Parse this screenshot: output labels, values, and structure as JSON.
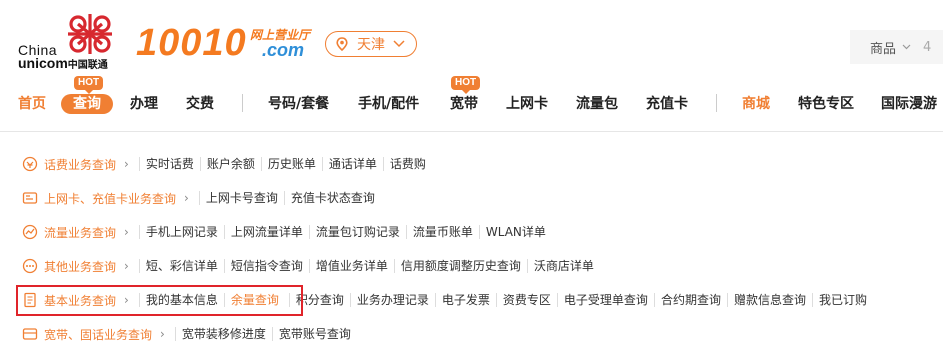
{
  "logo": {
    "line1": "China",
    "line2": "unicom",
    "cn": "中国联通",
    "brand_number": "10010",
    "brand_sub": "网上营业厅",
    "brand_domain": ".com"
  },
  "city": {
    "label": "天津"
  },
  "search": {
    "category": "商品",
    "overflow": "4"
  },
  "nav": {
    "items": [
      {
        "label": "首页"
      },
      {
        "label": "查询",
        "badge": "HOT"
      },
      {
        "label": "办理"
      },
      {
        "label": "交费"
      },
      {
        "label": "号码/套餐"
      },
      {
        "label": "手机/配件"
      },
      {
        "label": "宽带",
        "badge": "HOT"
      },
      {
        "label": "上网卡"
      },
      {
        "label": "流量包"
      },
      {
        "label": "充值卡"
      },
      {
        "label": "商城"
      },
      {
        "label": "特色专区"
      },
      {
        "label": "国际漫游"
      }
    ]
  },
  "rows": [
    {
      "category": "话费业务查询",
      "items": [
        "实时话费",
        "账户余额",
        "历史账单",
        "通话详单",
        "话费购"
      ]
    },
    {
      "category": "上网卡、充值卡业务查询",
      "items": [
        "上网卡号查询",
        "充值卡状态查询"
      ]
    },
    {
      "category": "流量业务查询",
      "items": [
        "手机上网记录",
        "上网流量详单",
        "流量包订购记录",
        "流量币账单",
        "WLAN详单"
      ]
    },
    {
      "category": "其他业务查询",
      "items": [
        "短、彩信详单",
        "短信指令查询",
        "增值业务详单",
        "信用额度调整历史查询",
        "沃商店详单"
      ]
    },
    {
      "category": "基本业务查询",
      "items": [
        "我的基本信息",
        "余量查询",
        "积分查询",
        "业务办理记录",
        "电子发票",
        "资费专区",
        "电子受理单查询",
        "合约期查询",
        "赠款信息查询",
        "我已订购"
      ]
    },
    {
      "category": "宽带、固话业务查询",
      "items": [
        "宽带装移修进度",
        "宽带账号查询"
      ]
    }
  ],
  "colors": {
    "accent": "#f07f33",
    "highlight_border": "#e0242a",
    "domain_blue": "#2f8fd8"
  }
}
